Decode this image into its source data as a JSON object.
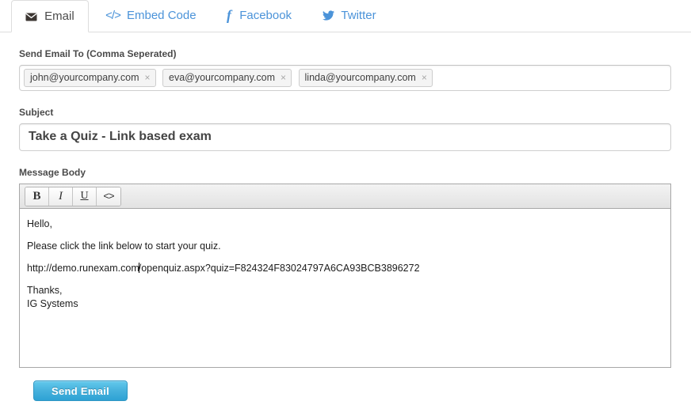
{
  "tabs": [
    {
      "label": "Email",
      "icon": "envelope-icon",
      "active": true
    },
    {
      "label": "Embed Code",
      "icon": "code-icon",
      "active": false
    },
    {
      "label": "Facebook",
      "icon": "facebook-icon",
      "active": false
    },
    {
      "label": "Twitter",
      "icon": "twitter-icon",
      "active": false
    }
  ],
  "recipients": {
    "label": "Send Email To (Comma Seperated)",
    "tokens": [
      "john@yourcompany.com",
      "eva@yourcompany.com",
      "linda@yourcompany.com"
    ],
    "remove_glyph": "×"
  },
  "subject": {
    "label": "Subject",
    "value": "Take a Quiz - Link based exam"
  },
  "message_body": {
    "label": "Message Body",
    "toolbar": [
      {
        "name": "bold-button",
        "label": "B"
      },
      {
        "name": "italic-button",
        "label": "I"
      },
      {
        "name": "underline-button",
        "label": "U"
      },
      {
        "name": "source-button",
        "label": "<>"
      }
    ],
    "lines": {
      "greeting": "Hello,",
      "instruction": "Please click the link below to start your quiz.",
      "link_before_caret": "http://demo.runexam.com",
      "link_after_caret": "/openquiz.aspx?quiz=F824324F83024797A6CA93BCB3896272",
      "signoff": "Thanks,",
      "signature": "IG Systems"
    }
  },
  "actions": {
    "send_label": "Send Email"
  },
  "colors": {
    "link": "#4b93d9",
    "button_blue": "#2ea2d4",
    "border": "#dddddd",
    "text": "#4a4a4a"
  }
}
